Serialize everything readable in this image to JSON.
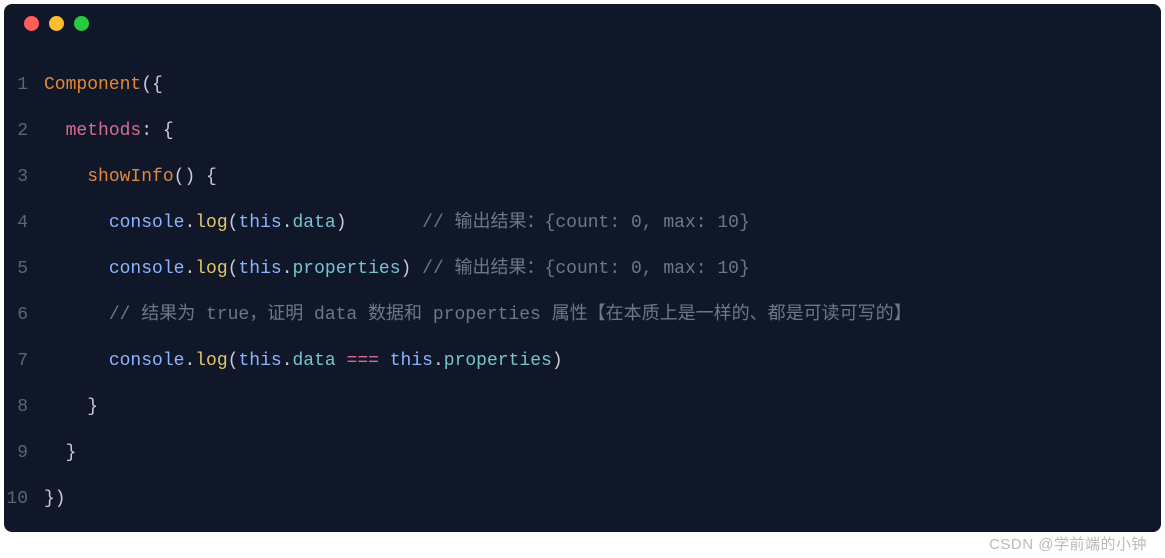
{
  "window": {
    "dots": [
      "red",
      "yellow",
      "green"
    ]
  },
  "code": {
    "lines": [
      {
        "n": "1",
        "tokens": [
          {
            "cls": "tk-call",
            "t": "Component"
          },
          {
            "cls": "tk-punc",
            "t": "({"
          }
        ]
      },
      {
        "n": "2",
        "indent": "  ",
        "tokens": [
          {
            "cls": "tk-key",
            "t": "methods"
          },
          {
            "cls": "tk-punc",
            "t": ": {"
          }
        ]
      },
      {
        "n": "3",
        "indent": "    ",
        "tokens": [
          {
            "cls": "tk-call",
            "t": "showInfo"
          },
          {
            "cls": "tk-punc",
            "t": "() {"
          }
        ]
      },
      {
        "n": "4",
        "indent": "      ",
        "tokens": [
          {
            "cls": "tk-builtin",
            "t": "console"
          },
          {
            "cls": "tk-punc",
            "t": "."
          },
          {
            "cls": "tk-method",
            "t": "log"
          },
          {
            "cls": "tk-punc",
            "t": "("
          },
          {
            "cls": "tk-builtin",
            "t": "this"
          },
          {
            "cls": "tk-punc",
            "t": "."
          },
          {
            "cls": "tk-prop",
            "t": "data"
          },
          {
            "cls": "tk-punc",
            "t": ")       "
          },
          {
            "cls": "tk-comment",
            "t": "// 输出结果：{count: 0, max: 10}"
          }
        ]
      },
      {
        "n": "5",
        "indent": "      ",
        "tokens": [
          {
            "cls": "tk-builtin",
            "t": "console"
          },
          {
            "cls": "tk-punc",
            "t": "."
          },
          {
            "cls": "tk-method",
            "t": "log"
          },
          {
            "cls": "tk-punc",
            "t": "("
          },
          {
            "cls": "tk-builtin",
            "t": "this"
          },
          {
            "cls": "tk-punc",
            "t": "."
          },
          {
            "cls": "tk-prop",
            "t": "properties"
          },
          {
            "cls": "tk-punc",
            "t": ") "
          },
          {
            "cls": "tk-comment",
            "t": "// 输出结果：{count: 0, max: 10}"
          }
        ]
      },
      {
        "n": "6",
        "indent": "      ",
        "tokens": [
          {
            "cls": "tk-comment",
            "t": "// 结果为 true，证明 data 数据和 properties 属性【在本质上是一样的、都是可读可写的】"
          }
        ]
      },
      {
        "n": "7",
        "indent": "      ",
        "tokens": [
          {
            "cls": "tk-builtin",
            "t": "console"
          },
          {
            "cls": "tk-punc",
            "t": "."
          },
          {
            "cls": "tk-method",
            "t": "log"
          },
          {
            "cls": "tk-punc",
            "t": "("
          },
          {
            "cls": "tk-builtin",
            "t": "this"
          },
          {
            "cls": "tk-punc",
            "t": "."
          },
          {
            "cls": "tk-prop",
            "t": "data"
          },
          {
            "cls": "tk-punc",
            "t": " "
          },
          {
            "cls": "tk-op",
            "t": "==="
          },
          {
            "cls": "tk-punc",
            "t": " "
          },
          {
            "cls": "tk-builtin",
            "t": "this"
          },
          {
            "cls": "tk-punc",
            "t": "."
          },
          {
            "cls": "tk-prop",
            "t": "properties"
          },
          {
            "cls": "tk-punc",
            "t": ")"
          }
        ]
      },
      {
        "n": "8",
        "indent": "    ",
        "tokens": [
          {
            "cls": "tk-punc",
            "t": "}"
          }
        ]
      },
      {
        "n": "9",
        "indent": "  ",
        "tokens": [
          {
            "cls": "tk-punc",
            "t": "}"
          }
        ]
      },
      {
        "n": "10",
        "tokens": [
          {
            "cls": "tk-punc",
            "t": "})"
          }
        ]
      }
    ]
  },
  "watermark": "CSDN @学前端的小钟"
}
